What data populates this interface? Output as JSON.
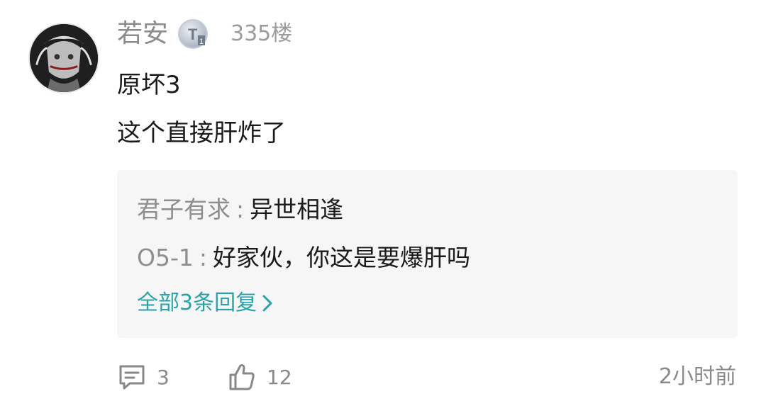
{
  "comment": {
    "username": "若安",
    "level_badge": "T1",
    "floor": "335楼",
    "content_lines": [
      "原坏3",
      "这个直接肝炸了"
    ],
    "comment_count": "3",
    "like_count": "12",
    "time": "2小时前"
  },
  "replies": [
    {
      "author": "君子有求",
      "separator": ":",
      "text": "异世相逢"
    },
    {
      "author": "O5-1",
      "separator": ":",
      "text": "好家伙，你这是要爆肝吗"
    }
  ],
  "more_replies_label": "全部3条回复",
  "icons": {
    "avatar": "anime-avatar",
    "badge": "level-badge-icon",
    "more": "chevron-right-icon",
    "comment": "comment-icon",
    "like": "thumbs-up-icon"
  },
  "colors": {
    "accent": "#2aa3a8",
    "reply_bg": "#f6f6f6",
    "muted_text": "#8c8c8c"
  }
}
